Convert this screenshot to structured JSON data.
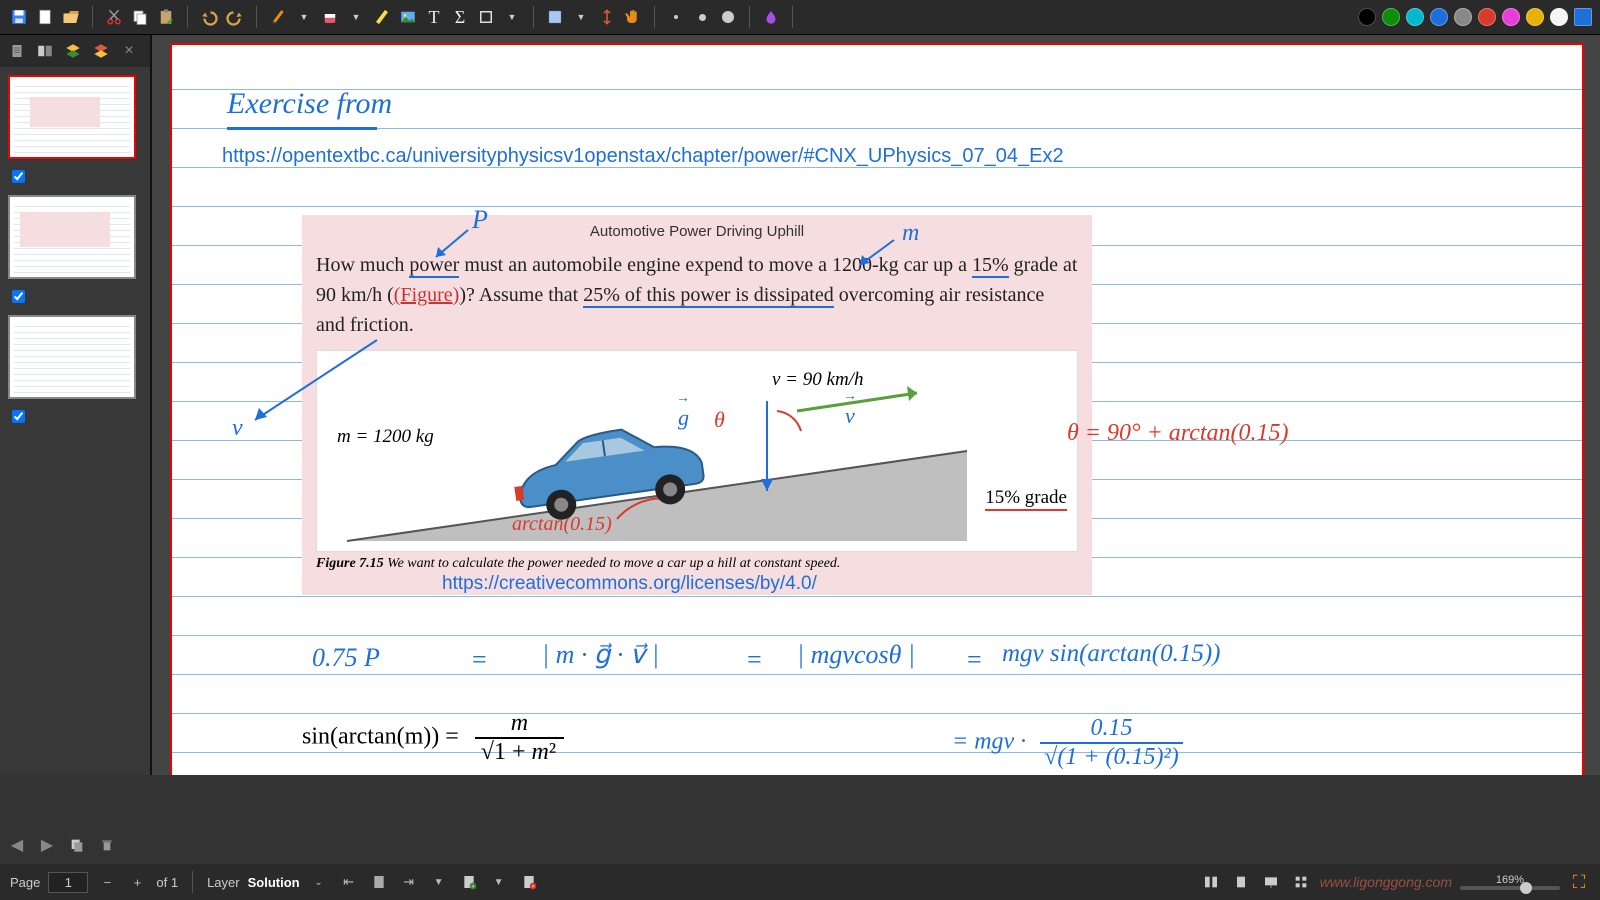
{
  "toolbar": {
    "save": "save",
    "new": "new",
    "open": "open",
    "cut": "cut",
    "copy": "copy",
    "paste": "paste",
    "undo": "undo",
    "redo": "redo",
    "pen": "pen",
    "eraser": "eraser",
    "highlighter": "highlighter",
    "image": "image",
    "text_T": "T",
    "math_sigma": "Σ",
    "shapes": "shapes",
    "select_rect": "select",
    "vresize": "vresize",
    "hand": "hand",
    "dots": [
      "small",
      "med",
      "large"
    ],
    "blob_color": "#a74de8",
    "palette": [
      "#000000",
      "#0b8f0b",
      "#00b8cc",
      "#1e6fd9",
      "#888888",
      "#d93a2b",
      "#e83ed9",
      "#e8b000",
      "#f5f5f5",
      "#1e6fd9"
    ]
  },
  "sidebar": {
    "tabs": [
      "single-page",
      "double-page",
      "layers",
      "annotations",
      "close"
    ],
    "thumbs": [
      {
        "active": true
      },
      {
        "active": false
      },
      {
        "active": false
      }
    ]
  },
  "page": {
    "title_hand": "Exercise from",
    "url1": "https://opentextbc.ca/universityphysicsv1openstax/chapter/power/#CNX_UPhysics_07_04_Ex2",
    "url2": "https://creativecommons.org/licenses/by/4.0/",
    "embed": {
      "title": "Automotive Power Driving Uphill",
      "body_a": "How much ",
      "body_power": "power",
      "body_b": " must an automobile engine expend to move a 1200-kg car up a ",
      "body_15": "15%",
      "body_c": " grade at 90 km/h (",
      "fig_link": "(Figure)",
      "body_d": ")? Assume that ",
      "body_25": "25% of this power is dissipated",
      "body_e": " overcoming air resistance and friction.",
      "mass": "m  =  1200 kg",
      "vel": "v  =  90 km/h",
      "grade": "15% grade",
      "caption_a": "Figure 7.15 ",
      "caption_b": "We want to calculate the power needed to move a car up a hill at constant speed."
    },
    "annot": {
      "P": "P",
      "m": "m",
      "v": "v",
      "g": "g",
      "vvec": "v",
      "theta": "θ",
      "arctan_fig": "arctan(0.15)",
      "theta_eq": "θ = 90° + arctan(0.15)",
      "eq1_a": "0.75 P",
      "eq1_eq": "=",
      "eq1_b": "| m · g⃗ · v⃗ |",
      "eq1_c": "| mgvcosθ |",
      "eq1_d": "mgv sin(arctan(0.15))",
      "eq2_lhs": "sin(arctan(m))  =",
      "eq2_num": "m",
      "eq2_den": "√(1 + m²)",
      "eq3_a": "= mgv ·",
      "eq3_num": "0.15",
      "eq3_den": "√(1 + (0.15)²)"
    }
  },
  "statusbar": {
    "page_label": "Page",
    "page_num": "1",
    "of": "of 1",
    "layer_label": "Layer",
    "layer_val": "Solution",
    "zoom": "169%",
    "watermark": "www.ligonggong.com"
  }
}
